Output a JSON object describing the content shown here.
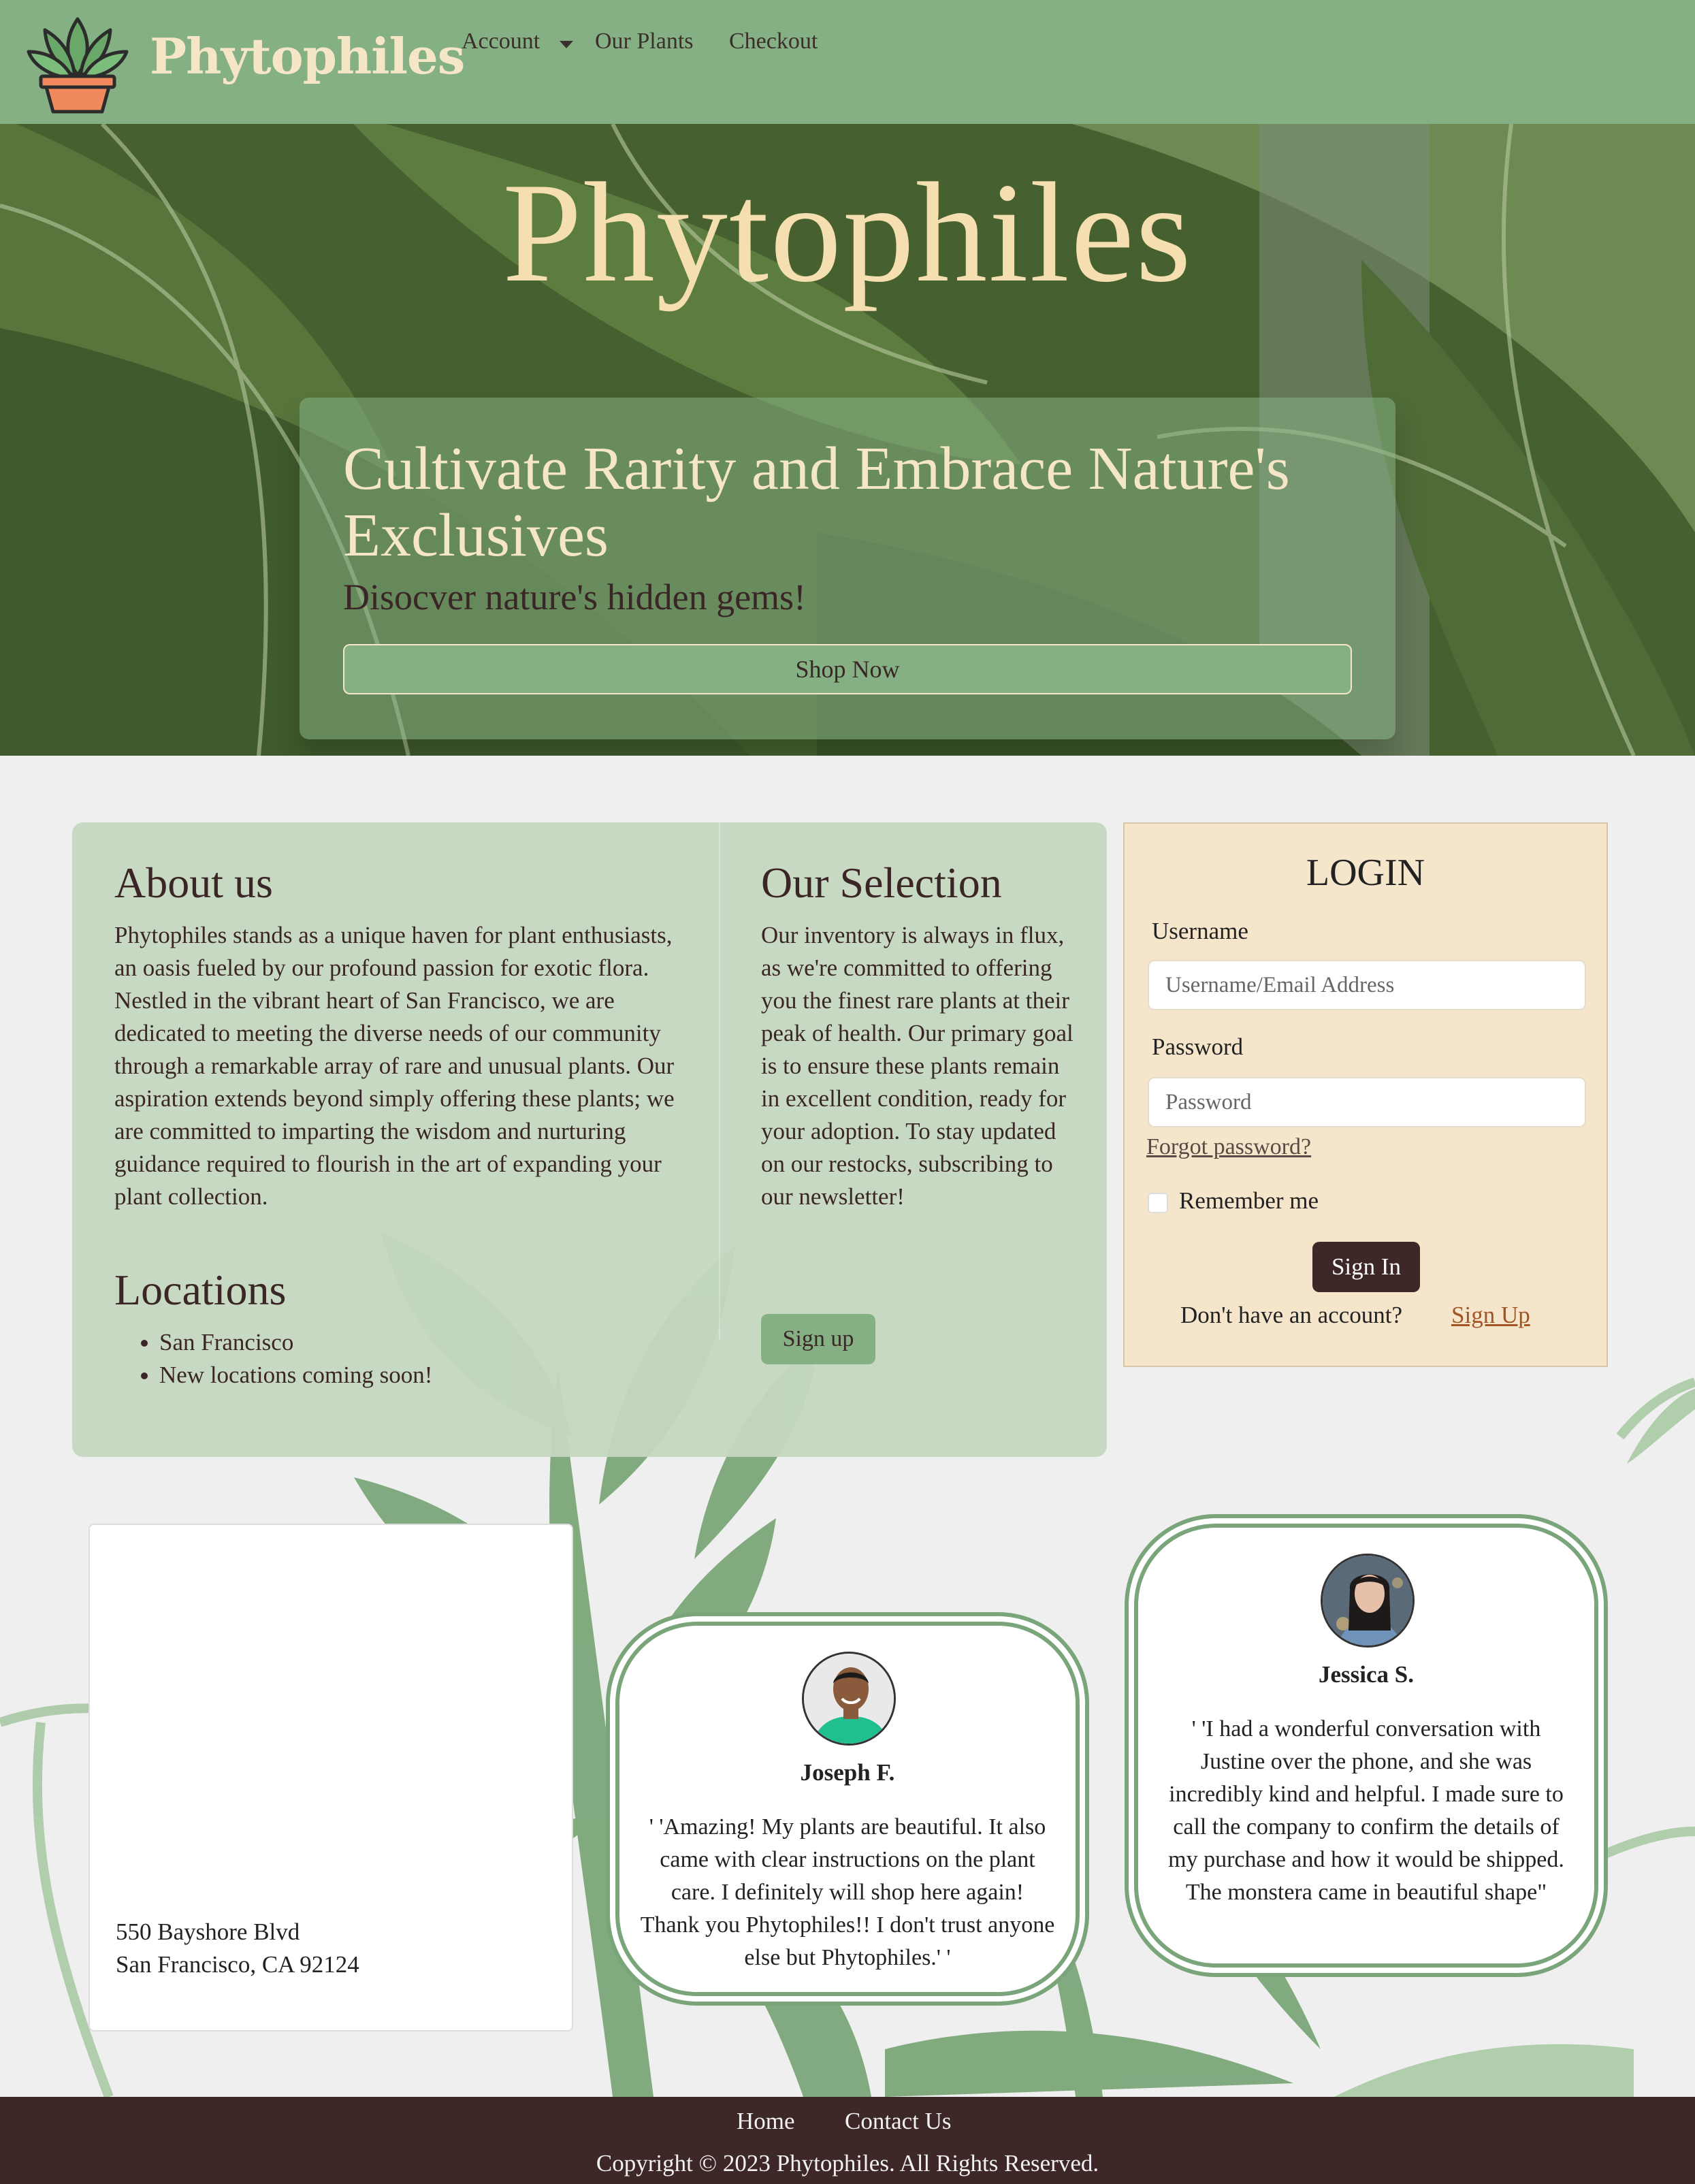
{
  "navbar": {
    "brand": "Phytophiles",
    "links": {
      "account": "Account",
      "plants": "Our Plants",
      "checkout": "Checkout"
    }
  },
  "hero": {
    "title": "Phytophiles",
    "heading": "Cultivate Rarity and Embrace Nature's Exclusives",
    "subheading": "Disocver nature's hidden gems!",
    "button": "Shop Now"
  },
  "about": {
    "heading": "About us",
    "text": "Phytophiles stands as a unique haven for plant enthusiasts, an oasis fueled by our profound passion for exotic flora. Nestled in the vibrant heart of San Francisco, we are dedicated to meeting the diverse needs of our community through a remarkable array of rare and unusual plants. Our aspiration extends beyond simply offering these plants; we are committed to imparting the wisdom and nurturing guidance required to flourish in the art of expanding your plant collection."
  },
  "locations": {
    "heading": "Locations",
    "items": [
      "San Francisco",
      "New locations coming soon!"
    ]
  },
  "selection": {
    "heading": "Our Selection",
    "text": "Our inventory is always in flux, as we're committed to offering you the finest rare plants at their peak of health. Our primary goal is to ensure these plants remain in excellent condition, ready for your adoption. To stay updated on our restocks, subscribing to our newsletter!",
    "button": "Sign up"
  },
  "login": {
    "title": "LOGIN",
    "username_label": "Username",
    "username_placeholder": "Username/Email Address",
    "password_label": "Password",
    "password_placeholder": "Password",
    "forgot": "Forgot password?",
    "remember": "Remember me",
    "signin": "Sign In",
    "no_account": "Don't have an account?",
    "signup_link": "Sign Up"
  },
  "address": {
    "line1": "550 Bayshore Blvd",
    "line2": "San Francisco, CA 92124"
  },
  "testimonials": [
    {
      "name": "Joseph F.",
      "text": "' 'Amazing! My plants are beautiful. It also came with clear instructions on the plant care. I definitely will shop here again! Thank you Phytophiles!! I don't trust anyone else but Phytophiles.' '"
    },
    {
      "name": "Jessica S.",
      "text": "' 'I had a wonderful conversation with Justine over the phone, and she was incredibly kind and helpful. I made sure to call the company to confirm the details of my purchase and how it would be shipped. The monstera came in beautiful shape\""
    }
  ],
  "footer": {
    "home": "Home",
    "contact": "Contact Us",
    "copyright": "Copyright © 2023 Phytophiles. All Rights Reserved."
  },
  "colors": {
    "nav_green": "#85b084",
    "cream": "#f5e6c8",
    "dark_brown": "#3d2727",
    "info_bg": "#c5d7c0",
    "login_bg": "#f5e6cb",
    "link_orange": "#a35424"
  },
  "icons": {
    "brand": "potted-plant-icon",
    "account_caret": "chevron-down-icon"
  }
}
